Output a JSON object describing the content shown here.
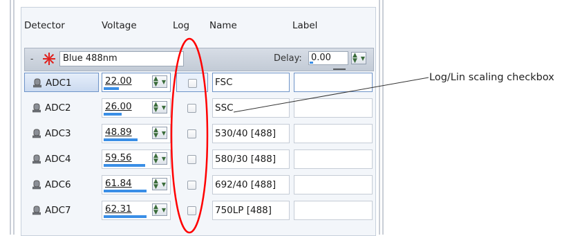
{
  "columns": {
    "detector": "Detector",
    "voltage": "Voltage",
    "log": "Log",
    "name": "Name",
    "label": "Label"
  },
  "laser": {
    "collapse_symbol": "-",
    "name": "Blue 488nm",
    "delay_label": "Delay:",
    "delay_value": "0.00",
    "delay_fraction": 0.1,
    "icon": "laser-starburst-icon",
    "icon_color": "#e0201c"
  },
  "rows": [
    {
      "detector": "ADC1",
      "voltage": "22.00",
      "voltage_fraction": 0.22,
      "log_checked": false,
      "name": "FSC",
      "label": ""
    },
    {
      "detector": "ADC2",
      "voltage": "26.00",
      "voltage_fraction": 0.26,
      "log_checked": false,
      "name": "SSC",
      "label": ""
    },
    {
      "detector": "ADC3",
      "voltage": "48.89",
      "voltage_fraction": 0.49,
      "log_checked": false,
      "name": "530/40 [488]",
      "label": ""
    },
    {
      "detector": "ADC4",
      "voltage": "59.56",
      "voltage_fraction": 0.6,
      "log_checked": false,
      "name": "580/30 [488]",
      "label": ""
    },
    {
      "detector": "ADC6",
      "voltage": "61.84",
      "voltage_fraction": 0.62,
      "log_checked": false,
      "name": "692/40 [488]",
      "label": ""
    },
    {
      "detector": "ADC7",
      "voltage": "62.31",
      "voltage_fraction": 0.62,
      "log_checked": false,
      "name": "750LP [488]",
      "label": ""
    }
  ],
  "annotation": {
    "callout_text": "Log/Lin scaling checkbox",
    "highlight_color": "#ff0000"
  },
  "colors": {
    "accent": "#3a8ee6",
    "selection_border": "#6d93c8"
  }
}
